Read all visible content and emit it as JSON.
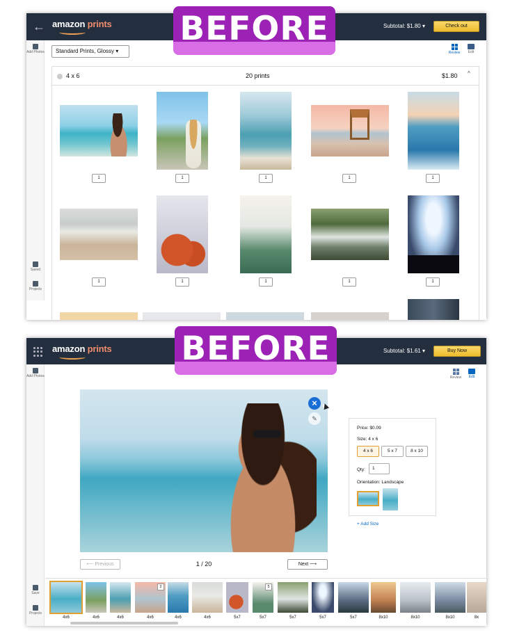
{
  "badge_text": "BEFORE",
  "screen1": {
    "logo_word1": "amazon",
    "logo_word2": "prints",
    "subtotal": "Subtotal: $1.80 ▾",
    "cta": "Check out",
    "dropdown": "Standard Prints, Glossy ▾",
    "view_review": "Review",
    "view_edit": "Edit",
    "rail_add": "Add Photos",
    "rail_saved": "Saved",
    "rail_projects": "Projects",
    "group_size": "4 x 6",
    "group_count": "20 prints",
    "group_price": "$1.80",
    "group_caret": "^",
    "quantities": [
      "1",
      "1",
      "1",
      "1",
      "1",
      "1",
      "1",
      "1",
      "1",
      "1"
    ]
  },
  "screen2": {
    "logo_word1": "amazon",
    "logo_word2": "prints",
    "subtotal": "Subtotal: $1.61 ▾",
    "cta": "Buy Now",
    "view_review": "Review",
    "view_edit": "Edit",
    "rail_add": "Add Photos",
    "rail_saved": "Save",
    "rail_projects": "Projects",
    "price": "Price: $0.09",
    "size_label": "Size: 4 x 6",
    "sizes": [
      "4 x 6",
      "5 x 7",
      "8 x 10"
    ],
    "qty_label": "Qty:",
    "qty_value": "1",
    "orientation": "Orientation: Landscape",
    "add_size": "+ Add Size",
    "prev": "⟵  Previous",
    "next": "Next  ⟶",
    "page": "1 / 20",
    "strip": [
      {
        "cap": "4x6",
        "badge": ""
      },
      {
        "cap": "4x6",
        "badge": ""
      },
      {
        "cap": "4x6",
        "badge": ""
      },
      {
        "cap": "4x6",
        "badge": "2"
      },
      {
        "cap": "4x6",
        "badge": ""
      },
      {
        "cap": "4x6",
        "badge": ""
      },
      {
        "cap": "5x7",
        "badge": ""
      },
      {
        "cap": "5x7",
        "badge": "5"
      },
      {
        "cap": "5x7",
        "badge": ""
      },
      {
        "cap": "5x7",
        "badge": ""
      },
      {
        "cap": "5x7",
        "badge": ""
      },
      {
        "cap": "8x10",
        "badge": ""
      },
      {
        "cap": "8x10",
        "badge": ""
      },
      {
        "cap": "8x10",
        "badge": ""
      },
      {
        "cap": "8x",
        "badge": ""
      }
    ]
  },
  "colors": {
    "topbar": "#232f3e",
    "accent": "#0066c0",
    "cta": "#f0c14b",
    "badge": "#9c22b6"
  }
}
